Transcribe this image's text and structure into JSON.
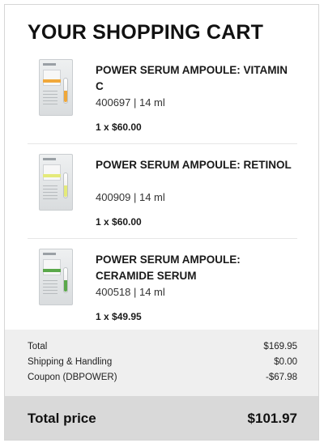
{
  "cart": {
    "title": "YOUR SHOPPING CART",
    "items": [
      {
        "name": "POWER SERUM AMPOULE: VITAMIN C",
        "meta": "400697 | 14 ml",
        "qty_price": "1 x $60.00",
        "accent_color": "#f0a83a"
      },
      {
        "name": "POWER SERUM AMPOULE: RETINOL",
        "meta": "400909 | 14 ml",
        "qty_price": "1 x $60.00",
        "accent_color": "#e4ea7a"
      },
      {
        "name": "POWER SERUM AMPOULE: CERAMIDE SERUM",
        "meta": "400518 | 14 ml",
        "qty_price": "1 x $49.95",
        "accent_color": "#5aa84a"
      }
    ]
  },
  "summary": {
    "rows": [
      {
        "label": "Total",
        "value": "$169.95"
      },
      {
        "label": "Shipping & Handling",
        "value": "$0.00"
      },
      {
        "label": "Coupon (DBPOWER)",
        "value": "-$67.98"
      }
    ],
    "total_label": "Total price",
    "total_value": "$101.97"
  },
  "colors": {
    "summary_bg": "#efefef",
    "total_bg": "#d9d9d9",
    "border": "#d6d6d6"
  },
  "icons": {
    "product_thumb": "product-image-ampoule"
  }
}
